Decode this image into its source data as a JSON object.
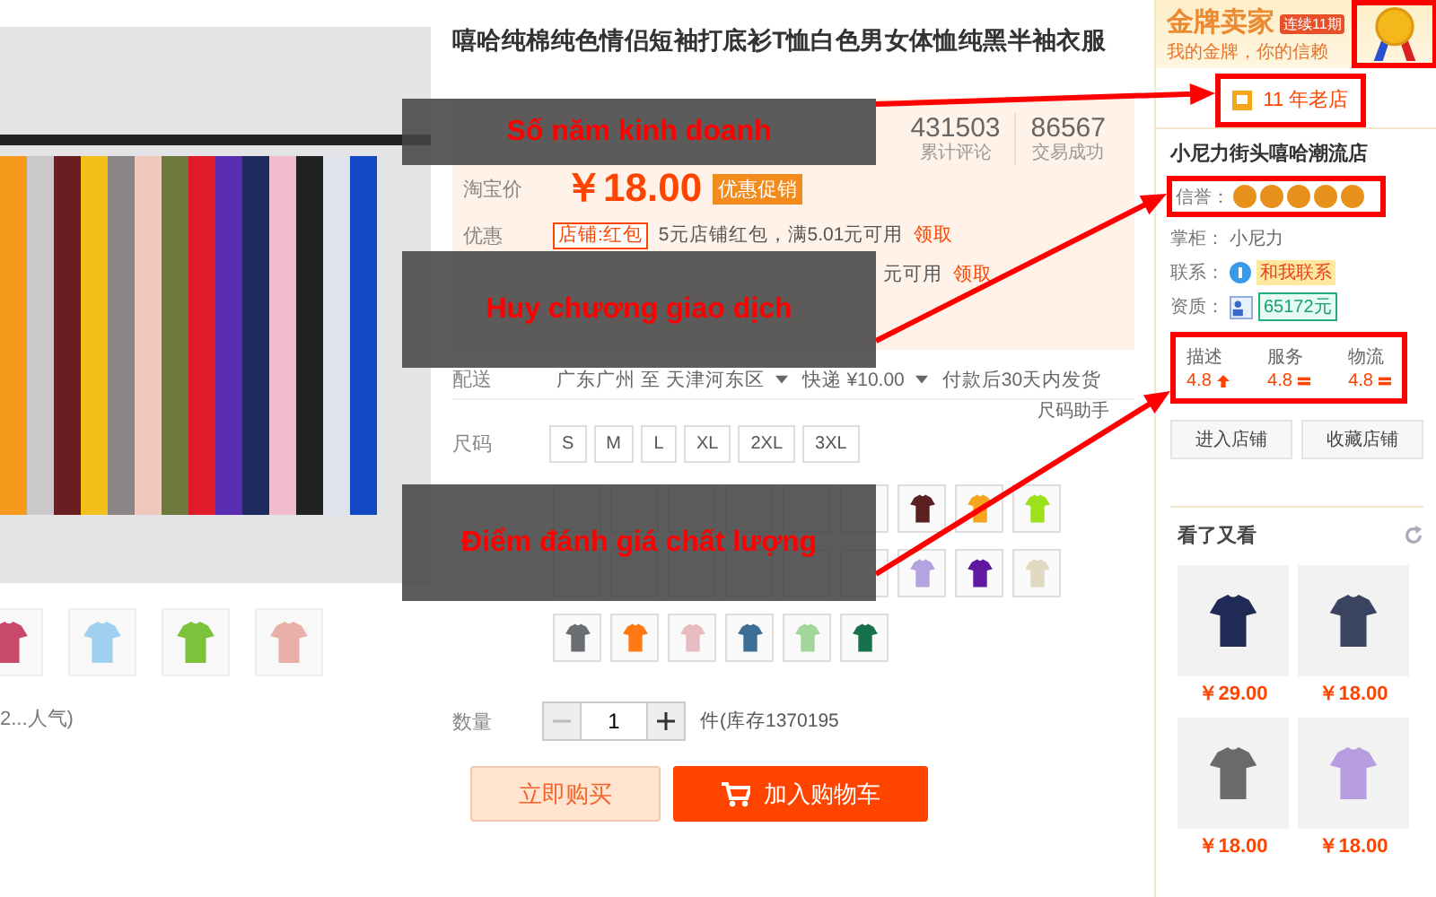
{
  "gallery": {
    "thumbnails": [
      {
        "color": "#c84a6a"
      },
      {
        "color": "#9fd0f0"
      },
      {
        "color": "#7cc23b"
      },
      {
        "color": "#e8b0a8"
      }
    ],
    "popularity": "2...人气)"
  },
  "product": {
    "title": "嘻哈纯棉纯色情侣短袖打底衫T恤白色男女体恤纯黑半袖衣服",
    "stats": [
      {
        "value": "431503",
        "label": "累计评论"
      },
      {
        "value": "86567",
        "label": "交易成功"
      }
    ],
    "price_label": "淘宝价",
    "price": "￥18.00",
    "price_badge": "优惠促销",
    "coupon_label": "优惠",
    "coupons": [
      {
        "tag": "店铺:红包",
        "text": "5元店铺红包，满5.01元可用",
        "action": "领取"
      },
      {
        "text": "元可用",
        "action": "领取"
      }
    ],
    "shipping": {
      "label": "配送",
      "route": "广东广州 至 天津河东区",
      "fee": "快递 ¥10.00",
      "note": "付款后30天内发货"
    },
    "size_helper": "尺码助手",
    "size_label": "尺码",
    "sizes": [
      "S",
      "M",
      "L",
      "XL",
      "2XL",
      "3XL"
    ],
    "colors": [
      {
        "hidden": true
      },
      {
        "hidden": true
      },
      {
        "hidden": true
      },
      {
        "hidden": true
      },
      {
        "hidden": true
      },
      {
        "hidden": true
      },
      {
        "color": "#5a1f1f"
      },
      {
        "color": "#f7a51c"
      },
      {
        "color": "#9be21c"
      },
      {
        "hidden": true
      },
      {
        "hidden": true
      },
      {
        "hidden": true
      },
      {
        "hidden": true
      },
      {
        "hidden": true
      },
      {
        "hidden": true
      },
      {
        "color": "#b5a3e0"
      },
      {
        "color": "#6018a0"
      },
      {
        "color": "#e0d8c0"
      },
      {
        "color": "#6b6e73"
      },
      {
        "color": "#ff7a14"
      },
      {
        "color": "#e6bcc0"
      },
      {
        "color": "#3d6e95"
      },
      {
        "color": "#a3d69a"
      },
      {
        "color": "#16704a"
      }
    ],
    "quantity_label": "数量",
    "quantity": "1",
    "stock": "件(库存1370195",
    "buy_button": "立即购买",
    "cart_button": "加入购物车"
  },
  "seller": {
    "title": "金牌卖家",
    "streak": "连续11期",
    "slogan": "我的金牌，你的信赖",
    "years": "11 年老店",
    "shop_name": "小尼力街头嘻哈潮流店",
    "credit": {
      "label": "信誉：",
      "stars": 5
    },
    "owner_label": "掌柜：",
    "owner": "小尼力",
    "contact_label": "联系：",
    "contact": "和我联系",
    "qualification_label": "资质：",
    "deposit": "65172元",
    "ratings": [
      {
        "label": "描述",
        "score": "4.8",
        "rising": true
      },
      {
        "label": "服务",
        "score": "4.8",
        "rising": false
      },
      {
        "label": "物流",
        "score": "4.8",
        "rising": false
      }
    ],
    "buttons": [
      "进入店铺",
      "收藏店铺"
    ]
  },
  "recommend": {
    "title": "看了又看",
    "items": [
      {
        "price": "￥29.00",
        "color": "#1f2a55"
      },
      {
        "price": "￥18.00",
        "color": "#3a4460"
      },
      {
        "price": "￥18.00",
        "color": "#6a6a6a"
      },
      {
        "price": "￥18.00",
        "color": "#b59de0"
      }
    ]
  },
  "annotations": [
    {
      "label": "Số năm kinh doanh"
    },
    {
      "label": "Huy chương giao dịch"
    },
    {
      "label": "Điểm đánh giá chất lượng"
    }
  ]
}
